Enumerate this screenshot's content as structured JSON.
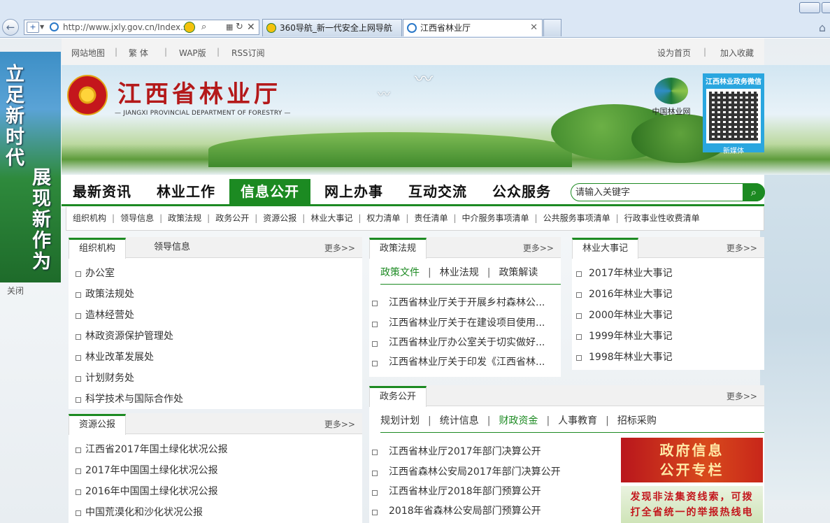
{
  "browser": {
    "url": "http://www.jxly.gov.cn/Index.s",
    "tabs": [
      {
        "label": "360导航_新一代安全上网导航"
      },
      {
        "label": "江西省林业厅"
      }
    ]
  },
  "float_ad": {
    "line1": "立足新时代",
    "line2": "展现新作为",
    "close_label": "关闭"
  },
  "topbar": {
    "links": [
      "网站地图",
      "繁 体",
      "WAP版",
      "RSS订阅"
    ],
    "set_home": "设为首页",
    "favorite": "加入收藏"
  },
  "banner": {
    "title": "江西省林业厅",
    "subtitle": "— JIANGXI PROVINCIAL DEPARTMENT OF FORESTRY —",
    "cf_label": "中国林业网",
    "qr_title": "江西林业政务微信",
    "qr_caption": "新媒体"
  },
  "main_nav": [
    "最新资讯",
    "林业工作",
    "信息公开",
    "网上办事",
    "互动交流",
    "公众服务"
  ],
  "search": {
    "placeholder": "请输入关键字"
  },
  "sub_nav": [
    "组织机构",
    "领导信息",
    "政策法规",
    "政务公开",
    "资源公报",
    "林业大事记",
    "权力清单",
    "责任清单",
    "中介服务事项清单",
    "公共服务事项清单",
    "行政事业性收费清单"
  ],
  "more_label": "更多>>",
  "org": {
    "tab_active": "组织机构",
    "tab2": "领导信息",
    "items": [
      "办公室",
      "政策法规处",
      "造林经营处",
      "林政资源保护管理处",
      "林业改革发展处",
      "计划财务处",
      "科学技术与国际合作处"
    ]
  },
  "policy": {
    "tab": "政策法规",
    "subtabs": [
      "政策文件",
      "林业法规",
      "政策解读"
    ],
    "items": [
      "江西省林业厅关于开展乡村森林公...",
      "江西省林业厅关于在建设项目使用...",
      "江西省林业厅办公室关于切实做好...",
      "江西省林业厅关于印发《江西省林..."
    ]
  },
  "events": {
    "tab": "林业大事记",
    "items": [
      "2017年林业大事记",
      "2016年林业大事记",
      "2000年林业大事记",
      "1999年林业大事记",
      "1998年林业大事记"
    ]
  },
  "resource": {
    "tab": "资源公报",
    "items": [
      "江西省2017年国土绿化状况公报",
      "2017年中国国土绿化状况公报",
      "2016年中国国土绿化状况公报",
      "中国荒漠化和沙化状况公报"
    ]
  },
  "affairs": {
    "tab": "政务公开",
    "subtabs": [
      "规划计划",
      "统计信息",
      "财政资金",
      "人事教育",
      "招标采购"
    ],
    "items": [
      "江西省林业厅2017年部门决算公开",
      "江西省森林公安局2017年部门决算公开",
      "江西省林业厅2018年部门预算公开",
      "2018年省森林公安局部门预算公开"
    ]
  },
  "side_banner1": {
    "line1": "政府信息",
    "line2": "公开专栏"
  },
  "side_banner2": {
    "line1": "发现非法集资线索，可拨",
    "line2": "打全省统一的举报热线电"
  }
}
